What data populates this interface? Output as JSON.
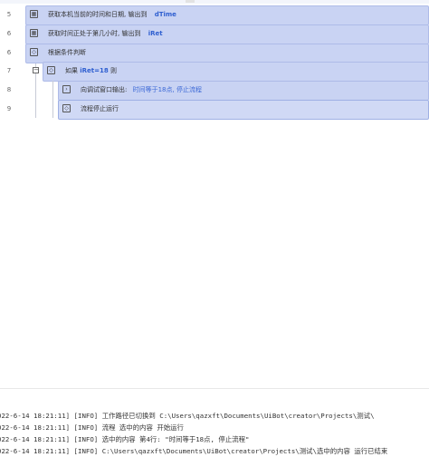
{
  "editor": {
    "rows": [
      {
        "line": "5",
        "text": "获取本机当前的时间和日期, 输出到",
        "var": "dTime"
      },
      {
        "line": "6",
        "text": "获取时间正处于第几小时, 输出到",
        "var": "iRet"
      },
      {
        "line": "6",
        "text": "根据条件判断"
      },
      {
        "line": "7",
        "prefix": "如果",
        "cond": "iRet=18",
        "suffix": "则",
        "toggle": "−"
      },
      {
        "line": "8",
        "text": "向调试窗口输出:",
        "value": "时间等于18点, 停止流程"
      },
      {
        "line": "9",
        "text": "流程停止运行"
      }
    ]
  },
  "console": {
    "lines": [
      "022-6-14 18:21:11] [INFO] 工作路径已切换到 C:\\Users\\qazxft\\Documents\\UiBot\\creator\\Projects\\测试\\",
      "022-6-14 18:21:11] [INFO] 流程 选中的内容 开始运行",
      "022-6-14 18:21:11] [INFO] 选中的内容 第4行: \"时间等于18点, 停止流程\"",
      "022-6-14 18:21:11] [INFO] C:\\Users\\qazxft\\Documents\\UiBot\\creator\\Projects\\测试\\选中的内容 运行已结束"
    ]
  },
  "colors": {
    "selection": "#c9d3f3",
    "keyword": "#2f5fd0"
  }
}
